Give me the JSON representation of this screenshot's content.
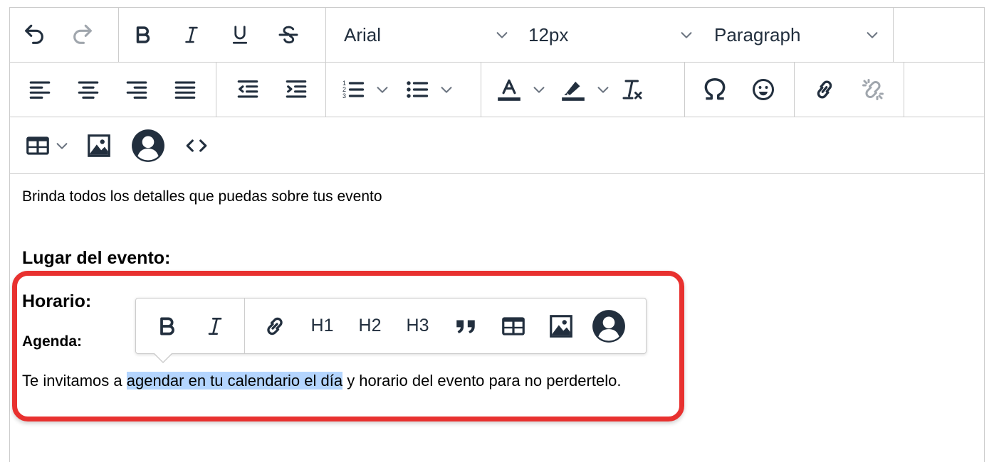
{
  "toolbar": {
    "row1": {
      "undo_icon": "undo-icon",
      "redo_icon": "redo-icon",
      "bold_icon": "bold-icon",
      "italic_icon": "italic-icon",
      "underline_icon": "underline-icon",
      "strikethrough_icon": "strikethrough-icon",
      "font_family": "Arial",
      "font_size": "12px",
      "block_format": "Paragraph"
    },
    "row2": {
      "icons": [
        "align-left-icon",
        "align-center-icon",
        "align-right-icon",
        "align-justify-icon",
        "outdent-icon",
        "indent-icon",
        "numbered-list-icon",
        "bullet-list-icon",
        "text-color-icon",
        "highlight-icon",
        "clear-formatting-icon",
        "special-character-icon",
        "emoji-icon",
        "link-icon",
        "unlink-icon"
      ]
    },
    "row3": {
      "icons": [
        "table-icon",
        "image-icon",
        "avatar-icon",
        "code-icon"
      ]
    }
  },
  "content": {
    "intro": "Brinda todos los detalles que puedas sobre tus evento",
    "heading_lugar": "Lugar del evento:",
    "heading_horario": "Horario:",
    "heading_agenda": "Agenda:",
    "para_before": "Te invitamos a ",
    "para_selected": "agendar en tu calendario el día",
    "para_after": " y horario del evento para no perdertelo."
  },
  "quick_toolbar": {
    "h1": "H1",
    "h2": "H2",
    "h3": "H3"
  },
  "colors": {
    "icon": "#222f3e",
    "disabled_icon": "#a0a6ad",
    "highlight_box": "#e8312f",
    "selection": "#b4d5fe",
    "border": "#cccccc"
  }
}
